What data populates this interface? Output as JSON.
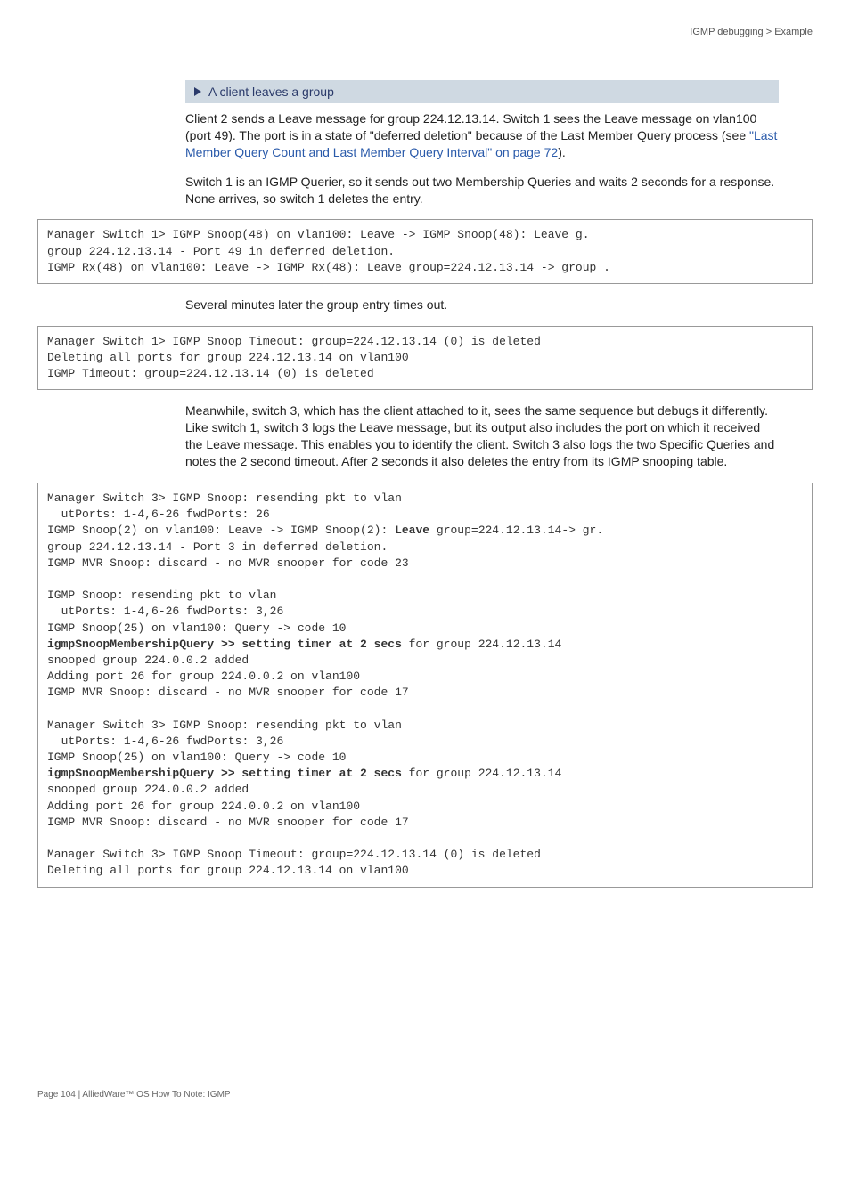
{
  "header": {
    "right": "IGMP debugging  >  Example"
  },
  "section": {
    "title": "A client leaves a group"
  },
  "para1_a": "Client 2 sends a Leave message for group 224.12.13.14. Switch 1 sees the Leave message on vlan100 (port 49). The port is in a state of \"deferred deletion\" because of the Last Member Query process (see ",
  "para1_link": "\"Last Member Query Count and Last Member Query Interval\" on page 72",
  "para1_b": ").",
  "para2": "Switch 1 is an IGMP Querier, so it sends out two Membership Queries and waits 2 seconds for a response. None arrives, so switch 1 deletes the entry.",
  "code1": "Manager Switch 1> IGMP Snoop(48) on vlan100: Leave -> IGMP Snoop(48): Leave g.\ngroup 224.12.13.14 - Port 49 in deferred deletion.\nIGMP Rx(48) on vlan100: Leave -> IGMP Rx(48): Leave group=224.12.13.14 -> group .",
  "para3": "Several minutes later the group entry times out.",
  "code2": "Manager Switch 1> IGMP Snoop Timeout: group=224.12.13.14 (0) is deleted\nDeleting all ports for group 224.12.13.14 on vlan100\nIGMP Timeout: group=224.12.13.14 (0) is deleted",
  "para4": "Meanwhile, switch 3, which has the client attached to it, sees the same sequence but debugs it differently. Like switch 1, switch 3 logs the Leave message, but its output also includes the port on which it received the Leave message. This enables you to identify the client. Switch 3 also logs the two Specific Queries and notes the 2 second timeout. After 2 seconds it also deletes the entry from its IGMP snooping table.",
  "code3": {
    "l1": "Manager Switch 3> IGMP Snoop: resending pkt to vlan",
    "l2": "  utPorts: 1-4,6-26 fwdPorts: 26",
    "l3a": "IGMP Snoop(2) on vlan100: Leave -> IGMP Snoop(2): ",
    "l3b": "Leave",
    "l3c": " group=224.12.13.14-> gr.",
    "l4": "group 224.12.13.14 - Port 3 in deferred deletion.",
    "l5": "IGMP MVR Snoop: discard - no MVR snooper for code 23",
    "l6": "IGMP Snoop: resending pkt to vlan",
    "l7": "  utPorts: 1-4,6-26 fwdPorts: 3,26",
    "l8": "IGMP Snoop(25) on vlan100: Query -> code 10",
    "l9a": "igmpSnoopMembershipQuery >> setting timer at 2 secs",
    "l9b": " for group 224.12.13.14",
    "l10": "snooped group 224.0.0.2 added",
    "l11": "Adding port 26 for group 224.0.0.2 on vlan100",
    "l12": "IGMP MVR Snoop: discard - no MVR snooper for code 17",
    "l13": "Manager Switch 3> IGMP Snoop: resending pkt to vlan",
    "l14": "  utPorts: 1-4,6-26 fwdPorts: 3,26",
    "l15": "IGMP Snoop(25) on vlan100: Query -> code 10",
    "l16a": "igmpSnoopMembershipQuery >> setting timer at 2 secs",
    "l16b": " for group 224.12.13.14",
    "l17": "snooped group 224.0.0.2 added",
    "l18": "Adding port 26 for group 224.0.0.2 on vlan100",
    "l19": "IGMP MVR Snoop: discard - no MVR snooper for code 17",
    "l20": "Manager Switch 3> IGMP Snoop Timeout: group=224.12.13.14 (0) is deleted",
    "l21": "Deleting all ports for group 224.12.13.14 on vlan100"
  },
  "footer": "Page 104 | AlliedWare™ OS How To Note: IGMP"
}
